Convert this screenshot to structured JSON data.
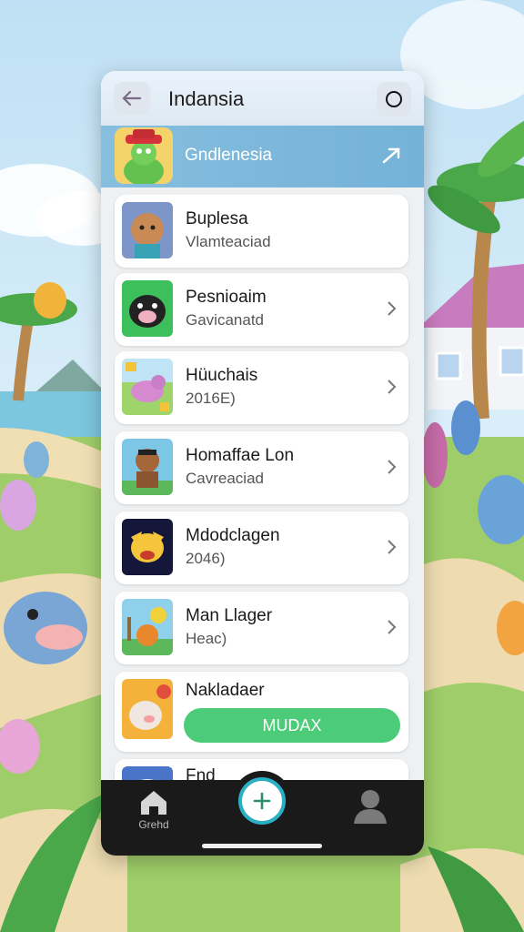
{
  "header": {
    "title": "Indansia",
    "back_icon": "arrow-left-icon",
    "right_icon": "circle-icon"
  },
  "banner": {
    "label": "Gndlenesia",
    "icon": "arrow-up-right-icon"
  },
  "list": {
    "items": [
      {
        "title": "Buplesa",
        "subtitle": "Vlamteaciad",
        "has_chevron": false
      },
      {
        "title": "Pesnioaim",
        "subtitle": "Gavicanatd",
        "has_chevron": true
      },
      {
        "title": "Hüuchais",
        "subtitle": "2016E)",
        "has_chevron": true
      },
      {
        "title": "Homaffae Lon",
        "subtitle": "Cavreaciad",
        "has_chevron": true
      },
      {
        "title": "Mdodclagen",
        "subtitle": "2046)",
        "has_chevron": true
      },
      {
        "title": "Man Llager",
        "subtitle": "Heac)",
        "has_chevron": true
      },
      {
        "title": "Nakladaer",
        "button_label": "MUDAX"
      },
      {
        "title": "Fnd"
      }
    ]
  },
  "bottom_nav": {
    "home_label": "Grehd",
    "home_icon": "home-icon",
    "add_icon": "plus-icon",
    "profile_icon": "person-icon"
  },
  "colors": {
    "banner": "#7bb8dc",
    "action_button": "#4ccc78",
    "fab_ring": "#29b0c4",
    "bottom_bar": "#1a1a1a"
  }
}
